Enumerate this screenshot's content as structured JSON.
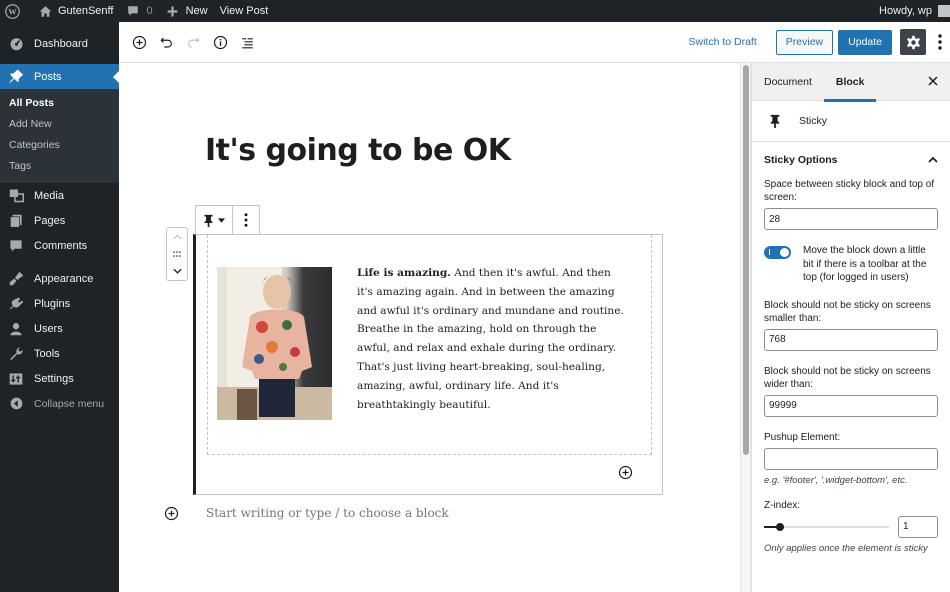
{
  "admin_bar": {
    "site_name": "GutenSenff",
    "comments_count": "0",
    "new_label": "New",
    "view_post_label": "View Post",
    "howdy": "Howdy, wp"
  },
  "sidebar": {
    "items": [
      {
        "label": "Dashboard",
        "icon": "dashboard-icon"
      },
      {
        "label": "Posts",
        "icon": "pin-icon",
        "current": true
      },
      {
        "label": "Media",
        "icon": "media-icon"
      },
      {
        "label": "Pages",
        "icon": "pages-icon"
      },
      {
        "label": "Comments",
        "icon": "comments-icon"
      },
      {
        "label": "Appearance",
        "icon": "appearance-icon"
      },
      {
        "label": "Plugins",
        "icon": "plugins-icon"
      },
      {
        "label": "Users",
        "icon": "users-icon"
      },
      {
        "label": "Tools",
        "icon": "tools-icon"
      },
      {
        "label": "Settings",
        "icon": "settings-icon"
      }
    ],
    "posts_submenu": [
      "All Posts",
      "Add New",
      "Categories",
      "Tags"
    ],
    "collapse_label": "Collapse menu"
  },
  "header": {
    "switch_to_draft": "Switch to Draft",
    "preview": "Preview",
    "update": "Update"
  },
  "editor": {
    "post_title": "It's going to be OK",
    "media_text": {
      "bold_lead": "Life is amazing.",
      "body": " And then it's awful. And then it's amazing again. And in between the amazing and awful it's ordinary and mundane and routine. Breathe in the amazing, hold on through the awful, and relax and exhale during the ordinary. That's just living heart-breaking, soul-healing, amazing, awful, ordinary life. And it's breathtakingly beautiful."
    },
    "default_appender_placeholder": "Start writing or type / to choose a block"
  },
  "settings_sidebar": {
    "tabs": [
      "Document",
      "Block"
    ],
    "active_tab": "Block",
    "block_card_title": "Sticky",
    "panel_title": "Sticky Options",
    "fields": {
      "offset_label": "Space between sticky block and top of screen:",
      "offset_value": "28",
      "toolbar_toggle_label": "Move the block down a little bit if there is a toolbar at the top (for logged in users)",
      "toolbar_toggle_on": true,
      "min_width_label": "Block should not be sticky on screens smaller than:",
      "min_width_value": "768",
      "max_width_label": "Block should not be sticky on screens wider than:",
      "max_width_value": "99999",
      "pushup_label": "Pushup Element:",
      "pushup_value": "",
      "pushup_help": "e.g. '#footer', '.widget-bottom', etc.",
      "zindex_label": "Z-index:",
      "zindex_value": "1",
      "zindex_slider_fraction": 0.13,
      "zindex_help": "Only applies once the element is sticky"
    }
  },
  "colors": {
    "admin_dark": "#1d2327",
    "accent": "#2271b1"
  }
}
